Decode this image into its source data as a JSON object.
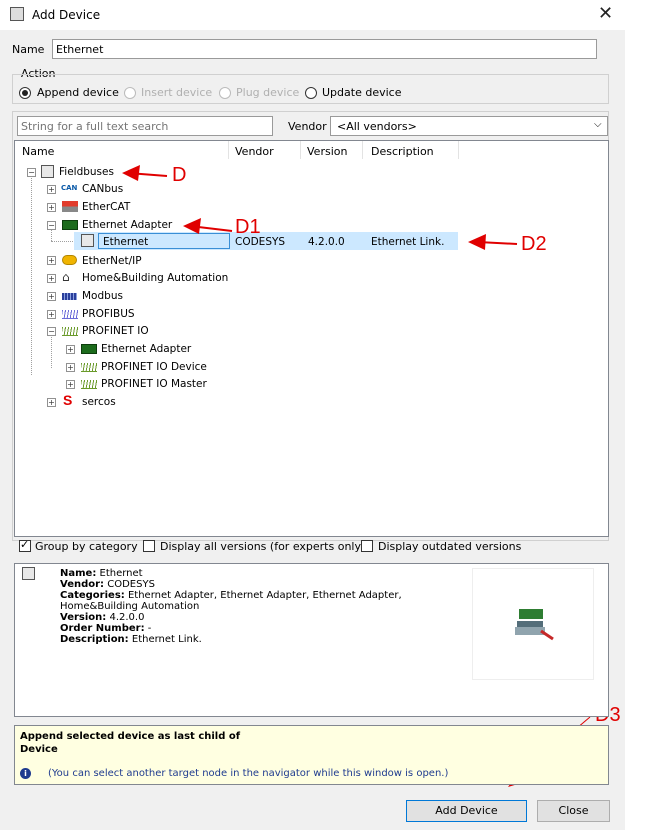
{
  "window": {
    "title": "Add Device",
    "close_glyph": "✕"
  },
  "name_label": "Name",
  "name_value": "Ethernet",
  "action": {
    "legend": "Action",
    "options": [
      {
        "label": "Append device",
        "selected": true,
        "enabled": true
      },
      {
        "label": "Insert device",
        "selected": false,
        "enabled": false
      },
      {
        "label": "Plug device",
        "selected": false,
        "enabled": false
      },
      {
        "label": "Update device",
        "selected": false,
        "enabled": true
      }
    ]
  },
  "search": {
    "placeholder": "String for a full text search",
    "vendor_label": "Vendor",
    "vendor_value": "<All vendors>"
  },
  "columns": [
    "Name",
    "Vendor",
    "Version",
    "Description"
  ],
  "tree": [
    {
      "label": "Fieldbuses",
      "icon": "device-icon"
    },
    {
      "label": "CANbus",
      "icon": "can-icon",
      "icon_text": "CAN"
    },
    {
      "label": "EtherCAT",
      "icon": "ethercat-icon"
    },
    {
      "label": "Ethernet Adapter",
      "icon": "ethernet-card-icon"
    },
    {
      "label": "Ethernet",
      "icon": "device-icon",
      "vendor": "CODESYS",
      "version": "4.2.0.0",
      "description": "Ethernet Link."
    },
    {
      "label": "EtherNet/IP",
      "icon": "ethernetip-icon"
    },
    {
      "label": "Home&Building Automation",
      "icon": "home-icon"
    },
    {
      "label": "Modbus",
      "icon": "modbus-icon"
    },
    {
      "label": "PROFIBUS",
      "icon": "profibus-icon"
    },
    {
      "label": "PROFINET IO",
      "icon": "profinet-icon"
    },
    {
      "label": "Ethernet Adapter",
      "icon": "ethernet-card-icon"
    },
    {
      "label": "PROFINET IO Device",
      "icon": "profinet-icon"
    },
    {
      "label": "PROFINET IO Master",
      "icon": "profinet-icon"
    },
    {
      "label": "sercos",
      "icon": "sercos-icon",
      "icon_text": "S"
    }
  ],
  "annotations": {
    "d": "D",
    "d1": "D1",
    "d2": "D2",
    "d3": "D3"
  },
  "options": {
    "group_by_category": "Group by category",
    "display_all_versions": "Display all versions (for experts only)",
    "display_outdated": "Display outdated versions"
  },
  "info": {
    "name_key": "Name:",
    "name_val": "Ethernet",
    "vendor_key": "Vendor:",
    "vendor_val": "CODESYS",
    "categories_key": "Categories:",
    "categories_val": "Ethernet Adapter, Ethernet Adapter, Ethernet Adapter,",
    "categories_val2": "Home&Building Automation",
    "version_key": "Version:",
    "version_val": "4.2.0.0",
    "order_key": "Order Number:",
    "order_val": "-",
    "desc_key": "Description:",
    "desc_val": "Ethernet Link."
  },
  "hint": {
    "line1": "Append selected device as last child of",
    "line2": "Device",
    "note": "(You can select another target node in the navigator while this window is open.)"
  },
  "buttons": {
    "add": "Add Device",
    "close": "Close"
  },
  "colors": {
    "accent_red": "#e00000",
    "selection": "#cce8ff",
    "hint_bg": "#ffffe1"
  }
}
